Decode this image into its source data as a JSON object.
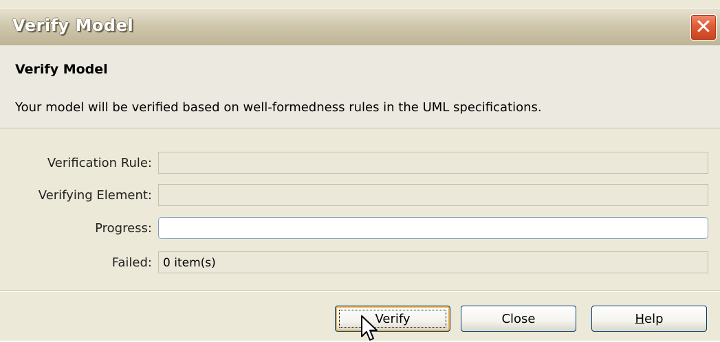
{
  "window": {
    "title": "Verify Model",
    "close_icon": "close-icon"
  },
  "header": {
    "section_title": "Verify Model",
    "description": "Your model will be verified based on well-formedness rules in the UML specifications."
  },
  "fields": {
    "verification_rule": {
      "label": "Verification Rule:",
      "value": ""
    },
    "verifying_element": {
      "label": "Verifying Element:",
      "value": ""
    },
    "progress": {
      "label": "Progress:",
      "value_percent": 0
    },
    "failed": {
      "label": "Failed:",
      "value": "0 item(s)"
    }
  },
  "buttons": {
    "verify": "Verify",
    "close": "Close",
    "help": "Help"
  },
  "colors": {
    "dialog_bg": "#ece9d8",
    "close_button": "#e05a35",
    "default_button_highlight": "#e9b24a"
  }
}
